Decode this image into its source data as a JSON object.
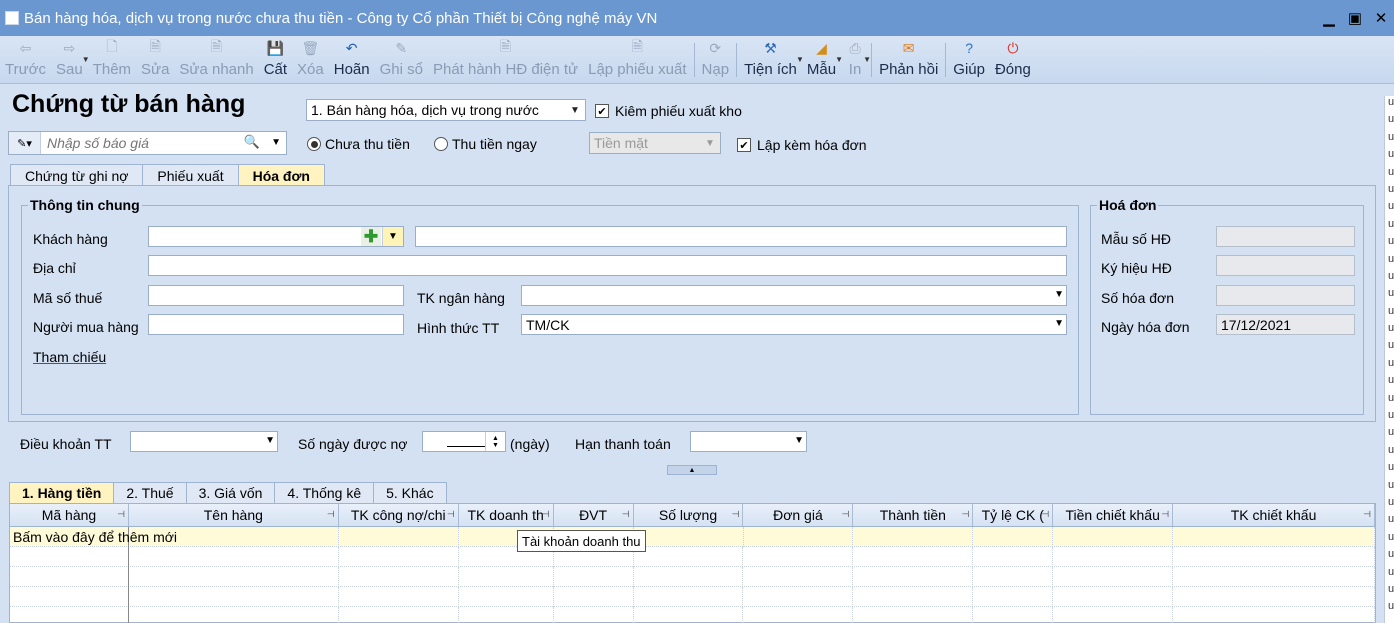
{
  "window": {
    "title": "Bán hàng hóa, dịch vụ trong nước chưa thu tiền - Công ty Cổ phần Thiết bị Công nghệ máy VN"
  },
  "toolbar": [
    {
      "label": "Trước",
      "icon": "arrow-left-icon",
      "enabled": false
    },
    {
      "label": "Sau",
      "icon": "arrow-right-icon",
      "enabled": false,
      "dropdown": true
    },
    {
      "label": "Thêm",
      "icon": "add-document-icon",
      "enabled": false
    },
    {
      "label": "Sửa",
      "icon": "edit-document-icon",
      "enabled": false
    },
    {
      "label": "Sửa nhanh",
      "icon": "quick-edit-icon",
      "enabled": false
    },
    {
      "label": "Cất",
      "icon": "save-icon",
      "enabled": true
    },
    {
      "label": "Xóa",
      "icon": "delete-icon",
      "enabled": false
    },
    {
      "label": "Hoãn",
      "icon": "undo-icon",
      "enabled": true
    },
    {
      "label": "Ghi sổ",
      "icon": "pencil-icon",
      "enabled": false
    },
    {
      "label": "Phát hành HĐ điện tử",
      "icon": "e-invoice-icon",
      "enabled": false
    },
    {
      "label": "Lập phiếu xuất",
      "icon": "export-slip-icon",
      "enabled": false
    },
    {
      "label": "Nạp",
      "icon": "reload-icon",
      "enabled": false
    },
    {
      "label": "Tiện ích",
      "icon": "tools-icon",
      "enabled": true,
      "dropdown": true
    },
    {
      "label": "Mẫu",
      "icon": "template-icon",
      "enabled": true,
      "dropdown": true
    },
    {
      "label": "In",
      "icon": "print-icon",
      "enabled": false,
      "dropdown": true
    },
    {
      "label": "Phản hồi",
      "icon": "feedback-mail-icon",
      "enabled": true
    },
    {
      "label": "Giúp",
      "icon": "help-icon",
      "enabled": true
    },
    {
      "label": "Đóng",
      "icon": "power-close-icon",
      "enabled": true
    }
  ],
  "page": {
    "title": "Chứng từ bán hàng",
    "type_select": "1. Bán hàng hóa, dịch vụ trong nước",
    "kiem_phieu_xuat_kho": {
      "label": "Kiêm phiếu xuất kho",
      "checked": true
    },
    "search_placeholder": "Nhập số báo giá",
    "chua_thu_tien": {
      "label": "Chưa thu tiền",
      "checked": true
    },
    "thu_tien_ngay": {
      "label": "Thu tiền ngay",
      "checked": false
    },
    "payment_method_select": "Tiền mặt",
    "lap_kem_hoa_don": {
      "label": "Lập kèm hóa đơn",
      "checked": true
    }
  },
  "tabs": [
    {
      "label": "Chứng từ ghi nợ",
      "active": false
    },
    {
      "label": "Phiếu xuất",
      "active": false
    },
    {
      "label": "Hóa đơn",
      "active": true
    }
  ],
  "thong_tin_chung": {
    "title": "Thông tin chung",
    "khach_hang": {
      "label": "Khách hàng",
      "code": "",
      "name": ""
    },
    "dia_chi": {
      "label": "Địa chỉ",
      "value": ""
    },
    "ma_so_thue": {
      "label": "Mã số thuế",
      "value": ""
    },
    "tk_ngan_hang": {
      "label": "TK ngân hàng",
      "value": ""
    },
    "nguoi_mua_hang": {
      "label": "Người mua hàng",
      "value": ""
    },
    "hinh_thuc_tt": {
      "label": "Hình thức TT",
      "value": "TM/CK"
    },
    "tham_chieu": {
      "label": "Tham chiếu"
    }
  },
  "hoa_don": {
    "title": "Hoá đơn",
    "mau_so": {
      "label": "Mẫu số HĐ",
      "value": ""
    },
    "ky_hieu": {
      "label": "Ký hiệu HĐ",
      "value": ""
    },
    "so_hoa_don": {
      "label": "Số hóa đơn",
      "value": ""
    },
    "ngay_hoa_don": {
      "label": "Ngày hóa đơn",
      "value": "17/12/2021"
    }
  },
  "payment_terms": {
    "dieu_khoan": {
      "label": "Điều khoản TT",
      "value": ""
    },
    "so_ngay": {
      "label": "Số ngày được nợ",
      "unit": "(ngày)",
      "value": ""
    },
    "han_thanh_toan": {
      "label": "Hạn thanh toán",
      "value": ""
    }
  },
  "grid_tabs": [
    {
      "label": "1. Hàng tiền",
      "active": true
    },
    {
      "label": "2. Thuế",
      "active": false
    },
    {
      "label": "3. Giá vốn",
      "active": false
    },
    {
      "label": "4. Thống kê",
      "active": false
    },
    {
      "label": "5. Khác",
      "active": false
    }
  ],
  "grid": {
    "columns": [
      "Mã hàng",
      "Tên hàng",
      "TK công nợ/chi",
      "TK doanh th",
      "ĐVT",
      "Số lượng",
      "Đơn giá",
      "Thành tiền",
      "Tỷ lệ CK (",
      "Tiền chiết khấu",
      "TK chiết khấu"
    ],
    "add_row_text": "Bấm vào đây để thêm mới",
    "tooltip": "Tài khoản doanh thu"
  },
  "right_edge_chars": [
    "u",
    "u",
    "u",
    "u",
    "u",
    "u",
    "u",
    "u",
    "u",
    "u",
    "u",
    "u",
    "u",
    "u",
    "u",
    "u",
    "u",
    "u",
    "u",
    "u",
    "u",
    "u",
    "u",
    "u",
    "u",
    "u",
    "u",
    "u",
    "u",
    "u"
  ]
}
